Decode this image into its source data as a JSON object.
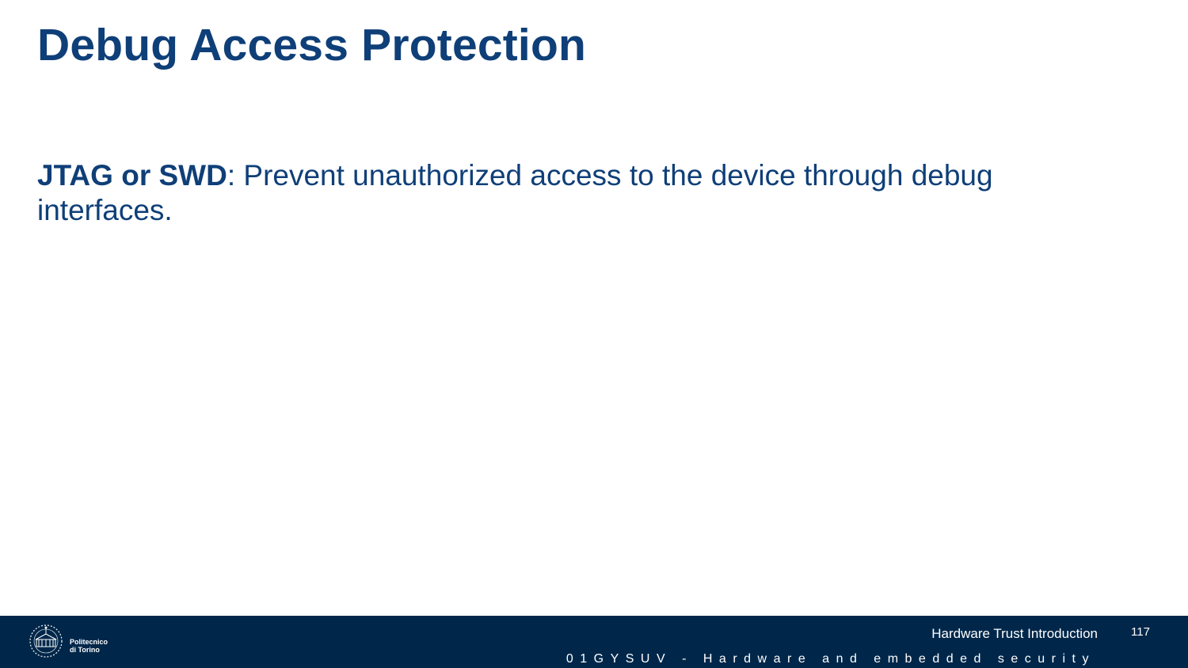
{
  "slide": {
    "title": "Debug Access Protection",
    "body": {
      "term": "JTAG or SWD",
      "separator": ":",
      "text": " Prevent unauthorized access to the device through debug interfaces."
    }
  },
  "footer": {
    "logo": {
      "line1": "Politecnico",
      "line2": "di Torino"
    },
    "topic": "Hardware Trust Introduction",
    "page_number": "117",
    "course": "01GYSUV - Hardware and embedded security"
  },
  "colors": {
    "title": "#0f3f78",
    "footer_background": "#00274a"
  }
}
